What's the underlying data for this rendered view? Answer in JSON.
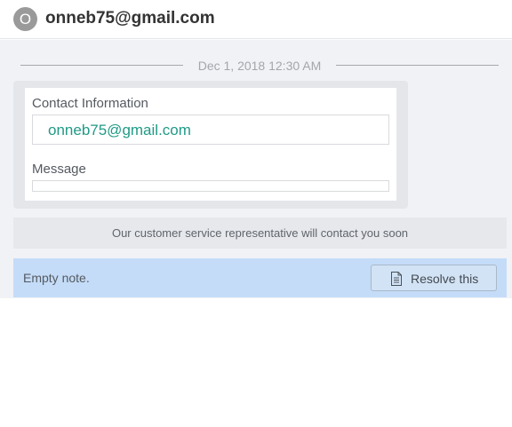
{
  "header": {
    "avatar_letter": "O",
    "title": "onneb75@gmail.com"
  },
  "conversation": {
    "timestamp": "Dec 1, 2018 12:30 AM",
    "form": {
      "contact_label": "Contact Information",
      "contact_value": "onneb75@gmail.com",
      "message_label": "Message",
      "message_value": ""
    },
    "notice": "Our customer service representative will contact you soon"
  },
  "note": {
    "text": "Empty note.",
    "resolve_label": "Resolve this",
    "resolve_icon": "document-icon"
  },
  "colors": {
    "accent_text": "#1f9a86",
    "note_background": "#c4dcf8",
    "panel_background": "#f1f2f6"
  }
}
